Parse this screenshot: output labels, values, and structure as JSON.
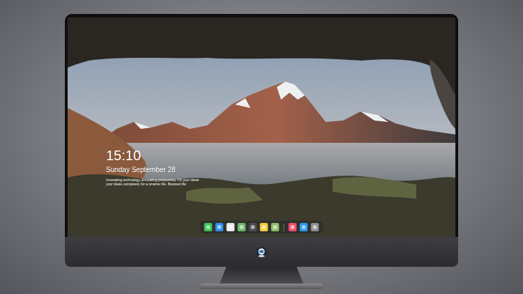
{
  "screen": {
    "clock": {
      "time": "15:10",
      "date": "Sunday September 28",
      "tagline": [
        "Innovating technology, Emulating productivity. Fill your ideas",
        "your ideas completely for a smarter life. Boosted life"
      ]
    }
  },
  "dock": {
    "apps": [
      {
        "color": "#3cc659"
      },
      {
        "color": "#2f8cf0"
      },
      {
        "color": "#e9e9ee"
      },
      {
        "color": "#69b86a"
      },
      {
        "color": "#4a4a52"
      },
      {
        "color": "#f5cf3a"
      },
      {
        "color": "#8fbf6a"
      }
    ],
    "recent": [
      {
        "color": "#f0506e"
      },
      {
        "color": "#2b9af3"
      },
      {
        "color": "#8e8e96"
      }
    ]
  }
}
